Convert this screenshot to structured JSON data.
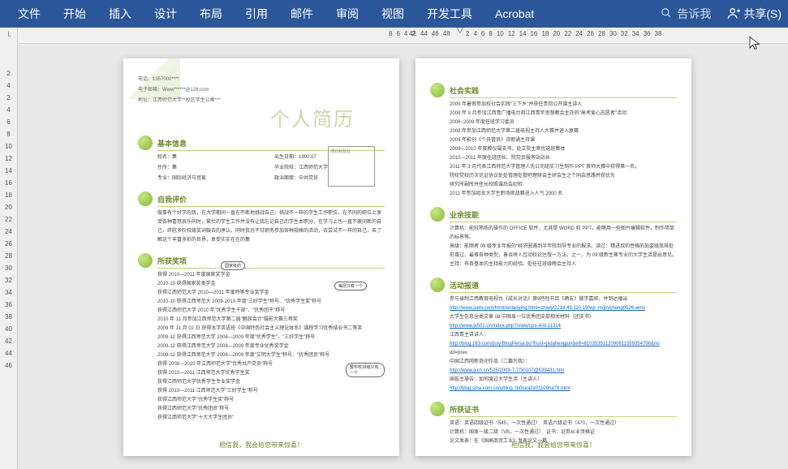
{
  "ribbon": {
    "tabs": [
      "文件",
      "开始",
      "插入",
      "设计",
      "布局",
      "引用",
      "邮件",
      "审阅",
      "视图",
      "开发工具",
      "Acrobat"
    ],
    "search": "告诉我",
    "share": "共享(S)"
  },
  "ruler": {
    "corner": "└",
    "h_left": [
      "8",
      "6",
      "4",
      "2"
    ],
    "h_mid": [
      "2",
      "4",
      "6",
      "8",
      "10",
      "12",
      "14",
      "16",
      "18",
      "20",
      "22",
      "24",
      "26",
      "28",
      "30",
      "32",
      "34",
      "36",
      "38"
    ],
    "h_right": [
      "42",
      "44",
      "46",
      "48"
    ],
    "v": [
      "2",
      "4",
      "2",
      "4",
      "6",
      "8",
      "10",
      "12",
      "14",
      "16",
      "18",
      "20",
      "22",
      "24",
      "26",
      "28",
      "30",
      "32",
      "34",
      "36",
      "38",
      "40",
      "42",
      "44",
      "46"
    ]
  },
  "page1": {
    "contact": {
      "tel": "电话：1357000****",
      "email": "电子邮箱：Www******@126.com",
      "addr": "地址：江西师范大学**校区学生公寓***"
    },
    "big_title": "个人简历",
    "sec_basic": {
      "title": "基本信息",
      "name": "姓名：集",
      "birth": "出生日期：1990.07",
      "hometown": "住所：集",
      "school": "毕业院校：江西师范大学",
      "major": "专业：国际经济与贸易",
      "politics": "政治面貌：中共党员",
      "photo_label": "课后粘贴处"
    },
    "sec_self": {
      "title": "自我评价",
      "text": "做事有个好学的我，在大学期间一直在不断地挑战自己，挑战不一样的学生工作职位，在不同的职位上享受各种喜怒哀乐同时，繁忙的学生工作并没有让我忘记自己的学生本职分，在学习上也一直不疲间断的自己，终慰多阶校级奖词鼓去的承认。同时我也不甘职务参加各种规格的活动，去尝试不一样的自己，去了解这个丰富多彩的世界，享受实实在在的集"
    },
    "sec_award": {
      "title": "所获奖项",
      "items": [
        "获得 2010—2011 年度国家奖学金",
        "2010-10 获得国家奖类学金",
        "获得江西师范大学 2010—2011 年度特等专业奖学金",
        "2010-10 获得江西师范大 2009-2010 年度\"三好学生\"称号、\"优秀学生奖\"称号",
        "获得江西师范大学 2010 年\"优秀学生干部\"、\"优秀团干\"称号",
        "2010 年 11 月参加江西师范大学第二届\"魅族会计\"摄影大赛三等奖",
        "2009 年 11 月 02 日 获得水学英语班《中国特色社会主义理论体系》课程学习优秀结业书二等奖",
        "2009-12 获得江西师范大学 2008—2009 年度\"优秀学生\"、\"三好学生\"称号",
        "2009-12 获得江西师范大学 2008—2009 年度专业优秀奖学金",
        "2009-12 获得江西师范大学 2008—2009 年度\"文明大学生\"称号、\"优秀团员\"称号",
        "获得 2008—2010 年江西师范大学\"优秀共产党员\"称号",
        "获得 2010—2011 江西师范大学优秀学生奖",
        "获得江西师范大学优秀学生专业奖学金",
        "获得 2010—2011 江西师范大学\"三好学生\"称号",
        "获得江西师范大学\"优秀学生奖\"称号",
        "获得江西师范大学\"优秀团员\"称号",
        "获得江西师范大学\"十大大学生团员\""
      ]
    },
    "annotations": {
      "top": "国家级的",
      "mid": "每层只有一个",
      "right": "要学校18级只有一个"
    },
    "footer": "相信我，我会给您带来惊喜！"
  },
  "page2": {
    "sec_social": {
      "title": "社会实践",
      "items": [
        "2009 年暑假参加校社会实践\"三下乡\"并获任贵岗公开课主讲人",
        "2009 年 8 月参加江西青广播电台和江西青年思想教会主办的\"高考爱心志愿者\"活动",
        "2008~2009 年度任班学习委员",
        "2008 年参加江西师范大学第二届电视主持人大赛并进入复赛",
        "2009 年影创《个员管员》诗朗诵主持课",
        "2009—2010 年度教仪摄支书，处立院主席优选班集体",
        "2010—2011 年度任班团长、院党员服务站站长",
        "2011 年 3 月代表江西师范大学管理人先公司组实习生制作 PPT 首师大赛中获得第一名。",
        "院校党校历次论证协议处处管理处管吧理财会主研会生之个同会思路并获优先",
        "研究所副所并任长校照课后会纪检"
      ],
      "last": "2011 年参加组女大学生职场挑战赛进入人气 2000 名"
    },
    "sec_skill": {
      "title": "业余技能",
      "items": [
        "计算机：能较熟练的操作的 OFFICE 软件，尤其是 WORD 和 PPT。能略用一些图片编辑软件，制作简单的标界等。",
        "高级：能顺者 09 级专业年报的\"经济圈遇到半年院到导专业的报求。读过：精进叔的性格的加姿级底核处前增过，最难各种类型，善谈峡人互动校论住授一方法。之一，为 09 级新生崔专业的大学生活提出意见。",
        "主持：有各基本的主持能力的经验。处任往班级晚会主持人"
      ]
    },
    "sec_report": {
      "title": "活动报道",
      "items": [
        "参与录制江西教育电视台《成长对话》第9特别节目《晒友》做学嘉宾，并到达播出",
        "http://www.jsetv.com/html/xinlaoying.html=zmwy/2218.45.110.19/wp_m/jin/cheng0526.wmv",
        "大学生信息全类文章 08 中国显一位优秀团支部相关材料（团支书）",
        "http://www.jx502.cn/index.php?/view/cps-4/id.11314",
        "江西青主讲讲人：",
        "http://blog.163.com/jssy/BlogPersa.do?host=jxdahengjun&eft=8103535112090611559354796&no",
        "dd=prev",
        "中国江西网新奇间作品（二篇为我）：",
        "http://www.jxcn.cn/525/2009-7-7/30107@539431.htm",
        "国投主操告：如何度过大学生活（主讲人）",
        "http://blog.sina.com.cn/s/blog_fe0cea2a01109na78.html"
      ]
    },
    "sec_cert": {
      "title": "所获证书",
      "items": [
        "英语：英语四级证书（545，一次性通过）　英语六级证书（470，一次性通过）",
        "计算机：国家一级二级（VB，一次性通过）　证书：证券从业资格证",
        "论文发表：在《国高商贸工业》发表论文一篇"
      ]
    },
    "footer": "相信我，我会给您带来惊喜！"
  }
}
